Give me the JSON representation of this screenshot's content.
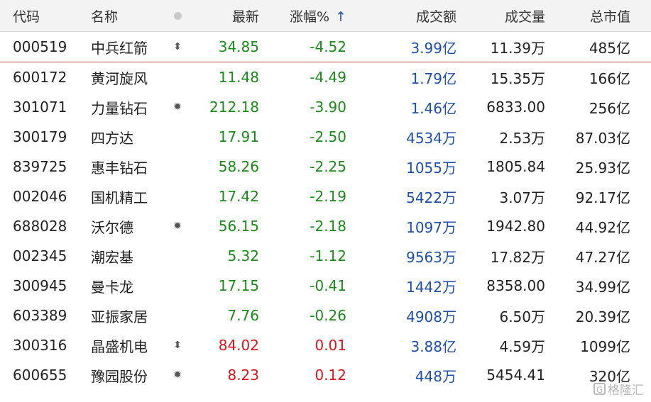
{
  "colors": {
    "up": "#e0131d",
    "down": "#1b8a1b",
    "amount": "#1e4fa8",
    "header_bg": "#f3f3f3"
  },
  "header": {
    "code": "代码",
    "name": "名称",
    "flag_icon": "dot-icon",
    "last": "最新",
    "change_pct": "涨幅%",
    "sort_icon": "↑",
    "amount": "成交额",
    "volume": "成交量",
    "market_cap": "总市值"
  },
  "rows": [
    {
      "code": "000519",
      "name": "中兵红箭",
      "flag": "⬍",
      "flag_icon": "updown-arrow-icon",
      "last": "34.85",
      "chg": "-4.52",
      "amount": "3.99亿",
      "volume": "11.39万",
      "cap": "485亿",
      "dir": "down"
    },
    {
      "code": "600172",
      "name": "黄河旋风",
      "flag": "",
      "flag_icon": "",
      "last": "11.48",
      "chg": "-4.49",
      "amount": "1.79亿",
      "volume": "15.35万",
      "cap": "166亿",
      "dir": "down"
    },
    {
      "code": "301071",
      "name": "力量钻石",
      "flag": "✹",
      "flag_icon": "star-burst-icon",
      "last": "212.18",
      "chg": "-3.90",
      "amount": "1.46亿",
      "volume": "6833.00",
      "cap": "256亿",
      "dir": "down"
    },
    {
      "code": "300179",
      "name": "四方达",
      "flag": "",
      "flag_icon": "",
      "last": "17.91",
      "chg": "-2.50",
      "amount": "4534万",
      "volume": "2.53万",
      "cap": "87.03亿",
      "dir": "down"
    },
    {
      "code": "839725",
      "name": "惠丰钻石",
      "flag": "",
      "flag_icon": "",
      "last": "58.26",
      "chg": "-2.25",
      "amount": "1055万",
      "volume": "1805.84",
      "cap": "25.93亿",
      "dir": "down"
    },
    {
      "code": "002046",
      "name": "国机精工",
      "flag": "",
      "flag_icon": "",
      "last": "17.42",
      "chg": "-2.19",
      "amount": "5422万",
      "volume": "3.07万",
      "cap": "92.17亿",
      "dir": "down"
    },
    {
      "code": "688028",
      "name": "沃尔德",
      "flag": "✹",
      "flag_icon": "star-burst-icon",
      "last": "56.15",
      "chg": "-2.18",
      "amount": "1097万",
      "volume": "1942.80",
      "cap": "44.92亿",
      "dir": "down"
    },
    {
      "code": "002345",
      "name": "潮宏基",
      "flag": "",
      "flag_icon": "",
      "last": "5.32",
      "chg": "-1.12",
      "amount": "9563万",
      "volume": "17.82万",
      "cap": "47.27亿",
      "dir": "down"
    },
    {
      "code": "300945",
      "name": "曼卡龙",
      "flag": "",
      "flag_icon": "",
      "last": "17.15",
      "chg": "-0.41",
      "amount": "1442万",
      "volume": "8358.00",
      "cap": "34.99亿",
      "dir": "down"
    },
    {
      "code": "603389",
      "name": "亚振家居",
      "flag": "",
      "flag_icon": "",
      "last": "7.76",
      "chg": "-0.26",
      "amount": "4908万",
      "volume": "6.50万",
      "cap": "20.39亿",
      "dir": "down"
    },
    {
      "code": "300316",
      "name": "晶盛机电",
      "flag": "⬍",
      "flag_icon": "updown-arrow-icon",
      "last": "84.02",
      "chg": "0.01",
      "amount": "3.88亿",
      "volume": "4.59万",
      "cap": "1099亿",
      "dir": "up"
    },
    {
      "code": "600655",
      "name": "豫园股份",
      "flag": "✹",
      "flag_icon": "star-burst-icon",
      "last": "8.23",
      "chg": "0.12",
      "amount": "448万",
      "volume": "5454.41",
      "cap": "320亿",
      "dir": "up"
    }
  ],
  "watermark": {
    "logo": "G",
    "text": "格隆汇"
  }
}
